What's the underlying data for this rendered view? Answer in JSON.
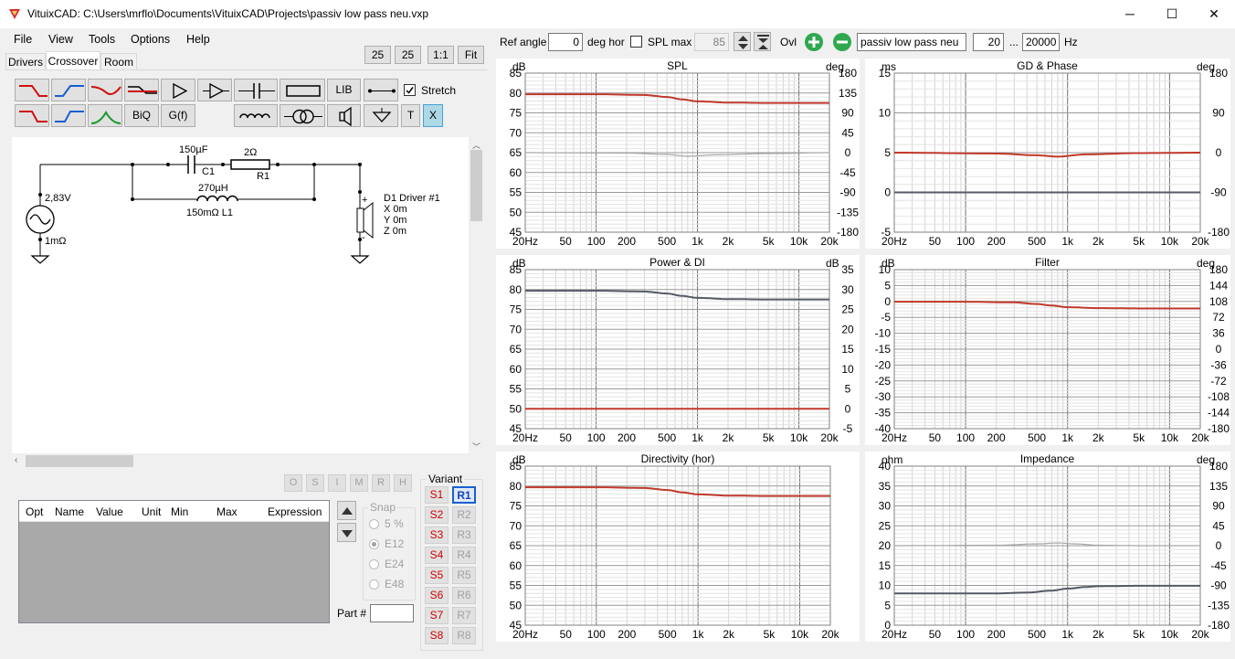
{
  "window": {
    "title": "VituixCAD: C:\\Users\\mrflo\\Documents\\VituixCAD\\Projects\\passiv low pass neu.vxp",
    "minimize": "─",
    "maximize": "☐",
    "close": "✕"
  },
  "menu": [
    "File",
    "View",
    "Tools",
    "Options",
    "Help"
  ],
  "zoom_buttons": [
    "25",
    "25",
    "1:1",
    "Fit"
  ],
  "tabs": [
    "Drivers",
    "Crossover",
    "Room"
  ],
  "toolbar": {
    "lib_label": "LIB",
    "biq_label": "BiQ",
    "gf_label": "G(f)",
    "t_label": "T",
    "x_label": "X",
    "stretch_label": "Stretch",
    "stretch_checked": true
  },
  "top_controls": {
    "ref_angle_label": "Ref angle",
    "ref_angle_value": "0",
    "deg_hor_label": "deg hor",
    "spl_max_label": "SPL max",
    "spl_max_value": "85",
    "ovl_label": "Ovl",
    "filename": "passiv low pass neu",
    "freq_min": "20",
    "freq_sep": "...",
    "freq_max": "20000",
    "hz_label": "Hz"
  },
  "schematic": {
    "source_voltage": "2,83V",
    "source_resistance": "1mΩ",
    "c1_value": "150µF",
    "c1_name": "C1",
    "r1_value": "2Ω",
    "r1_name": "R1",
    "l1_inductance": "270µH",
    "l1_resistance_name": "150mΩ L1",
    "driver_name": "D1 Driver #1",
    "driver_x": "X 0m",
    "driver_y": "Y 0m",
    "driver_z": "Z 0m",
    "plus": "+",
    "minus": "-"
  },
  "os_buttons": [
    "O",
    "S",
    "I",
    "M",
    "R",
    "H"
  ],
  "params_table": {
    "headers": [
      "Opt",
      "Name",
      "Value",
      "Unit",
      "Min",
      "Max",
      "Expression"
    ]
  },
  "snap": {
    "label": "Snap",
    "options": [
      "5 %",
      "E12",
      "E24",
      "E48"
    ],
    "selected": 1
  },
  "part_label": "Part #",
  "variant": {
    "label": "Variant",
    "s_buttons": [
      "S1",
      "S2",
      "S3",
      "S4",
      "S5",
      "S6",
      "S7",
      "S8"
    ],
    "r_buttons": [
      "R1",
      "R2",
      "R3",
      "R4",
      "R5",
      "R6",
      "R7",
      "R8"
    ],
    "active_r": 0
  },
  "colors": {
    "red_trace": "#c0392b",
    "dark_trace": "#555a66",
    "gray_trace": "#a8a8a8",
    "grid": "#d0d0d0"
  },
  "chart_data": [
    {
      "type": "line",
      "title": "SPL",
      "x_ticks": [
        "20Hz",
        "50",
        "100",
        "200",
        "500",
        "1k",
        "2k",
        "5k",
        "10k",
        "20k"
      ],
      "left_unit": "dB",
      "left_ticks": [
        "85",
        "80",
        "75",
        "70",
        "65",
        "60",
        "55",
        "50",
        "45"
      ],
      "right_unit": "deg",
      "right_ticks": [
        "180",
        "135",
        "90",
        "45",
        "0",
        "-45",
        "-90",
        "-135",
        "-180"
      ],
      "ylim": [
        45,
        85
      ],
      "y2lim": [
        -180,
        180
      ],
      "series": [
        {
          "axis": "left",
          "color": "#c0392b",
          "x": [
            20,
            100,
            300,
            500,
            700,
            1000,
            2000,
            5000,
            20000
          ],
          "y": [
            79.7,
            79.7,
            79.5,
            79.0,
            78.4,
            77.9,
            77.6,
            77.5,
            77.5
          ]
        },
        {
          "axis": "right",
          "color": "#a8a8a8",
          "x": [
            20,
            200,
            500,
            800,
            1500,
            5000,
            20000
          ],
          "y": [
            0,
            -1,
            -4,
            -8,
            -5,
            -2,
            0
          ]
        }
      ]
    },
    {
      "type": "line",
      "title": "GD & Phase",
      "x_ticks": [
        "20Hz",
        "50",
        "100",
        "200",
        "500",
        "1k",
        "2k",
        "5k",
        "10k",
        "20k"
      ],
      "left_unit": "ms",
      "left_ticks": [
        "15",
        "10",
        "5",
        "0",
        "-5"
      ],
      "right_unit": "deg",
      "right_ticks": [
        "180",
        "90",
        "0",
        "-90",
        "-180"
      ],
      "ylim": [
        -5,
        15
      ],
      "y2lim": [
        -180,
        180
      ],
      "series": [
        {
          "axis": "right",
          "color": "#c0392b",
          "x": [
            20,
            200,
            500,
            800,
            1500,
            5000,
            20000
          ],
          "y": [
            0,
            -2,
            -6,
            -9,
            -4,
            -1,
            0
          ]
        },
        {
          "axis": "left",
          "color": "#555a66",
          "x": [
            20,
            20000
          ],
          "y": [
            0,
            0
          ]
        }
      ]
    },
    {
      "type": "line",
      "title": "Power & DI",
      "x_ticks": [
        "20Hz",
        "50",
        "100",
        "200",
        "500",
        "1k",
        "2k",
        "5k",
        "10k",
        "20k"
      ],
      "left_unit": "dB",
      "left_ticks": [
        "85",
        "80",
        "75",
        "70",
        "65",
        "60",
        "55",
        "50",
        "45"
      ],
      "right_unit": "dB",
      "right_ticks": [
        "35",
        "30",
        "25",
        "20",
        "15",
        "10",
        "5",
        "0",
        "-5"
      ],
      "ylim": [
        45,
        85
      ],
      "y2lim": [
        -5,
        35
      ],
      "series": [
        {
          "axis": "left",
          "color": "#555a66",
          "x": [
            20,
            100,
            300,
            500,
            700,
            1000,
            2000,
            5000,
            20000
          ],
          "y": [
            79.7,
            79.7,
            79.5,
            79.0,
            78.4,
            77.9,
            77.6,
            77.5,
            77.5
          ]
        },
        {
          "axis": "right",
          "color": "#c0392b",
          "x": [
            20,
            20000
          ],
          "y": [
            0,
            0
          ]
        }
      ]
    },
    {
      "type": "line",
      "title": "Filter",
      "x_ticks": [
        "20Hz",
        "50",
        "100",
        "200",
        "500",
        "1k",
        "2k",
        "5k",
        "10k",
        "20k"
      ],
      "left_unit": "dB",
      "left_ticks": [
        "10",
        "5",
        "0",
        "-5",
        "-10",
        "-15",
        "-20",
        "-25",
        "-30",
        "-35",
        "-40"
      ],
      "right_unit": "deg",
      "right_ticks": [
        "180",
        "144",
        "108",
        "72",
        "36",
        "0",
        "-36",
        "-72",
        "-108",
        "-144",
        "-180"
      ],
      "ylim": [
        -40,
        10
      ],
      "y2lim": [
        -180,
        180
      ],
      "series": [
        {
          "axis": "left",
          "color": "#c0392b",
          "x": [
            20,
            100,
            300,
            500,
            700,
            1000,
            2000,
            5000,
            20000
          ],
          "y": [
            -0.1,
            -0.1,
            -0.3,
            -0.8,
            -1.3,
            -1.8,
            -2.1,
            -2.2,
            -2.2
          ]
        }
      ]
    },
    {
      "type": "line",
      "title": "Directivity (hor)",
      "x_ticks": [
        "20Hz",
        "50",
        "100",
        "200",
        "500",
        "1k",
        "2k",
        "5k",
        "10k",
        "20k"
      ],
      "left_unit": "dB",
      "left_ticks": [
        "85",
        "80",
        "75",
        "70",
        "65",
        "60",
        "55",
        "50",
        "45"
      ],
      "ylim": [
        45,
        85
      ],
      "series": [
        {
          "axis": "left",
          "color": "#c0392b",
          "x": [
            20,
            100,
            300,
            500,
            700,
            1000,
            2000,
            5000,
            20000
          ],
          "y": [
            79.7,
            79.7,
            79.5,
            79.0,
            78.4,
            77.9,
            77.6,
            77.5,
            77.5
          ]
        }
      ]
    },
    {
      "type": "line",
      "title": "Impedance",
      "x_ticks": [
        "20Hz",
        "50",
        "100",
        "200",
        "500",
        "1k",
        "2k",
        "5k",
        "10k",
        "20k"
      ],
      "left_unit": "ohm",
      "left_ticks": [
        "40",
        "35",
        "30",
        "25",
        "20",
        "15",
        "10",
        "5",
        "0"
      ],
      "right_unit": "deg",
      "right_ticks": [
        "180",
        "135",
        "90",
        "45",
        "0",
        "-45",
        "-90",
        "-135",
        "-180"
      ],
      "ylim": [
        0,
        40
      ],
      "y2lim": [
        -180,
        180
      ],
      "series": [
        {
          "axis": "left",
          "color": "#555a66",
          "x": [
            20,
            200,
            400,
            700,
            1000,
            1500,
            2000,
            5000,
            20000
          ],
          "y": [
            8,
            8,
            8.2,
            8.7,
            9.2,
            9.6,
            9.8,
            9.9,
            9.9
          ]
        },
        {
          "axis": "right",
          "color": "#a8a8a8",
          "x": [
            20,
            200,
            500,
            800,
            1200,
            2000,
            5000,
            20000
          ],
          "y": [
            0,
            1,
            4,
            6,
            4,
            1,
            0,
            0
          ]
        }
      ]
    }
  ]
}
